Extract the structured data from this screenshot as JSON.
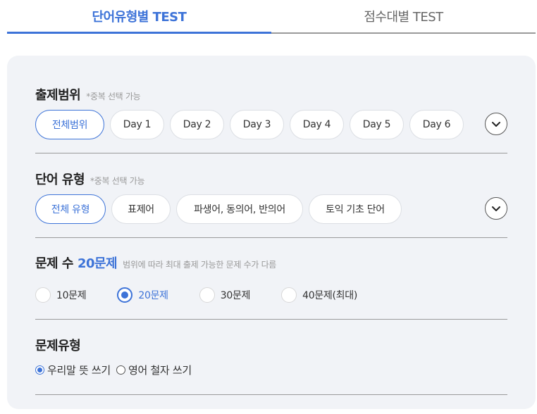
{
  "tabs": [
    {
      "label": "단어유형별 TEST",
      "active": true
    },
    {
      "label": "점수대별 TEST",
      "active": false
    }
  ],
  "range": {
    "title": "출제범위",
    "note": "*중복 선택 가능",
    "chips": [
      "전체범위",
      "Day 1",
      "Day 2",
      "Day 3",
      "Day 4",
      "Day 5",
      "Day 6"
    ],
    "selected": "전체범위",
    "expand_icon": "chevron-down-icon"
  },
  "word_type": {
    "title": "단어 유형",
    "note": "*중복 선택 가능",
    "chips": [
      "전체 유형",
      "표제어",
      "파생어, 동의어, 반의어",
      "토익 기초 단어"
    ],
    "selected": "전체 유형",
    "expand_icon": "chevron-down-icon"
  },
  "question_count": {
    "title": "문제 수",
    "count": "20문제",
    "note": "범위에 따라 최대 출제 가능한 문제 수가 다름",
    "options": [
      "10문제",
      "20문제",
      "30문제",
      "40문제(최대)"
    ],
    "selected": "20문제"
  },
  "question_type": {
    "title": "문제유형",
    "options": [
      "우리말 뜻 쓰기",
      "영어 철자 쓰기"
    ],
    "selected": "우리말 뜻 쓰기"
  },
  "colors": {
    "accent": "#3d73d8",
    "panel": "#f1f3f7"
  }
}
